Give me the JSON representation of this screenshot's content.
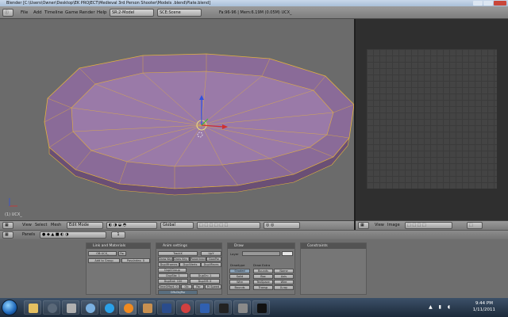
{
  "window": {
    "title": "Blender [C:\\Users\\Owner\\Desktop\\EK PROJECT\\Medieval 3rd Person Shooter\\Models .blend\\Plate.blend]"
  },
  "topbar": {
    "menus": [
      "File",
      "Add",
      "Timeline",
      "Game",
      "Render",
      "Help"
    ],
    "screen_field": "SR:2-Model",
    "scene_field": "SCE:Scene",
    "info": "Fa:96-96 | Mem:6.19M (0.05M) UCX_"
  },
  "viewport": {
    "object_label": "(1) UCX_"
  },
  "view_header": {
    "menus": [
      "View",
      "Select",
      "Mesh"
    ],
    "mode": "Edit Mode",
    "orientation": "Global"
  },
  "image_header": {
    "menus": [
      "View",
      "Image"
    ]
  },
  "buttons_header": {
    "panels_label": "Panels",
    "frame": "1"
  },
  "panels": {
    "link": {
      "title": "Link and Materials",
      "object_field": "OB:UCX_",
      "par_label": "Par",
      "add_to_group": "Add to Group",
      "passindex": "PassIndex: 0"
    },
    "anim": {
      "title": "Anim settings",
      "track": "TrackX",
      "upy": "UpY",
      "draw_key": "Draw Key",
      "draw_key_sel": "Draw Key Sel",
      "powertrack": "Powertrack",
      "slowpar": "SlowPar",
      "dupliframes": "DupliFrames",
      "dupliverts": "DupliVerts",
      "duplifaces": "DupliFaces",
      "dupligroup": "DupliGroup",
      "dupsta": "DupSta: 1",
      "dupon": "DupOn: 1",
      "dupend": "DupEnd: 100",
      "dupoff": "DupOff: 0",
      "timeoffset": "TimeOffset: 0.000",
      "offs_ob": "Ob",
      "offs_par": "Par",
      "prspeed": "Pr Speed",
      "offset_label": "OffsObjPar"
    },
    "draw": {
      "title": "Draw",
      "layers_label": "Layer",
      "drawtype_label": "Drawtype",
      "drawextra_label": "Draw Extra",
      "types": [
        "Shaded",
        "Solid",
        "Wire",
        "Bounds"
      ],
      "extra": [
        "Bounds",
        "Name",
        "Box",
        "Axis",
        "TexSpace",
        "Wire",
        "Transp",
        "X-ray"
      ]
    },
    "constraints": {
      "title": "Constraints"
    }
  },
  "taskbar": {
    "time": "9:44 PM",
    "date": "1/11/2011"
  },
  "colors": {
    "mesh_fill": "#8a6b98",
    "mesh_edge": "#e3b23c",
    "viewport_bg": "#6b6b6b"
  }
}
